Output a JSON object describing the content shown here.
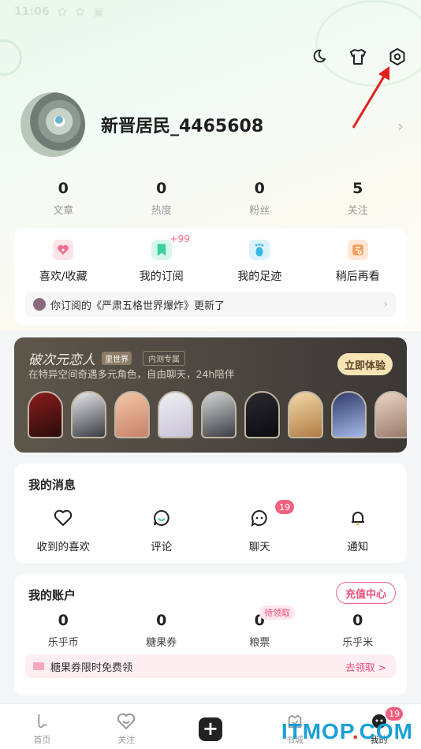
{
  "status_bar": {
    "time": "11:06"
  },
  "header": {
    "icons": [
      "moon-icon",
      "shirt-icon",
      "settings-icon"
    ]
  },
  "profile": {
    "username": "新晋居民_4465608"
  },
  "stats": [
    {
      "value": "0",
      "label": "文章"
    },
    {
      "value": "0",
      "label": "热度"
    },
    {
      "value": "0",
      "label": "粉丝"
    },
    {
      "value": "5",
      "label": "关注"
    }
  ],
  "quick_actions": {
    "items": [
      {
        "label": "喜欢/收藏",
        "icon": "heart-star-icon",
        "color": "#f06a8a"
      },
      {
        "label": "我的订阅",
        "icon": "bookmark-icon",
        "color": "#3ccf9a",
        "badge": "+99"
      },
      {
        "label": "我的足迹",
        "icon": "footprint-icon",
        "color": "#39b8e6"
      },
      {
        "label": "稍后再看",
        "icon": "read-later-icon",
        "color": "#f79d5a"
      }
    ],
    "notice": "你订阅的《严肃五格世界爆炸》更新了"
  },
  "banner": {
    "title": "破次元恋人",
    "tag": "里世界",
    "beta": "内测专属",
    "subtitle": "在特异空间奇遇多元角色，自由聊天，24h陪伴",
    "button": "立即体验"
  },
  "messages": {
    "title": "我的消息",
    "items": [
      {
        "label": "收到的喜欢",
        "icon": "heart-outline-icon"
      },
      {
        "label": "评论",
        "icon": "comment-icon"
      },
      {
        "label": "聊天",
        "icon": "chat-icon",
        "badge": "19"
      },
      {
        "label": "通知",
        "icon": "bell-icon"
      }
    ]
  },
  "account": {
    "title": "我的账户",
    "recharge": "充值中心",
    "items": [
      {
        "value": "0",
        "label": "乐乎币"
      },
      {
        "value": "0",
        "label": "糖果券"
      },
      {
        "value": "0",
        "label": "粮票",
        "badge": "待领取"
      },
      {
        "value": "0",
        "label": "乐乎米"
      }
    ],
    "promo_text": "糖果券限时免费领",
    "promo_action": "去领取 >"
  },
  "bottom_nav": {
    "items": [
      {
        "label": "首页"
      },
      {
        "label": "关注"
      },
      {
        "label": ""
      },
      {
        "label": "书城"
      },
      {
        "label": "我的",
        "badge": "19"
      }
    ]
  },
  "watermark": {
    "text": "ITMOP",
    "dot": ".",
    "suffix": "COM"
  },
  "colors": {
    "accent": "#ee4d78",
    "badge": "#f0607f",
    "banner_bg": "#4b4640"
  }
}
